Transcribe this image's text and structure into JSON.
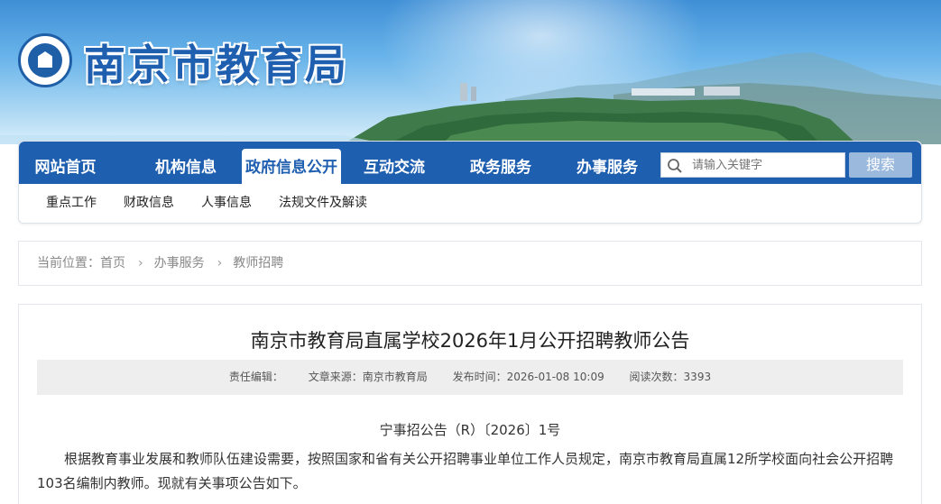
{
  "header": {
    "site_title": "南京市教育局",
    "logo_icon": "nanjing-education-emblem"
  },
  "nav": {
    "items": [
      {
        "label": "网站首页",
        "active": false
      },
      {
        "label": "机构信息",
        "active": false
      },
      {
        "label": "政府信息公开",
        "active": true
      },
      {
        "label": "互动交流",
        "active": false
      },
      {
        "label": "政务服务",
        "active": false
      },
      {
        "label": "办事服务",
        "active": false
      }
    ],
    "search_placeholder": "请输入关键字",
    "search_button": "搜索",
    "search_icon": "search-icon"
  },
  "subnav": {
    "items": [
      "重点工作",
      "财政信息",
      "人事信息",
      "法规文件及解读"
    ]
  },
  "breadcrumb": {
    "prefix": "当前位置：",
    "items": [
      "首页",
      "办事服务",
      "教师招聘"
    ]
  },
  "article": {
    "title": "南京市教育局直属学校2026年1月公开招聘教师公告",
    "meta": {
      "editor": "责任编辑：",
      "source": "文章来源：南京市教育局",
      "publish_time": "发布时间：2026-01-08 10:09",
      "views": "阅读次数：3393"
    },
    "doc_number": "宁事招公告（R）〔2026〕1号",
    "body": "根据教育事业发展和教师队伍建设需要，按照国家和省有关公开招聘事业单位工作人员规定，南京市教育局直属12所学校面向社会公开招聘103名编制内教师。现就有关事项公告如下。"
  },
  "colors": {
    "primary": "#1f5fb0",
    "search_button": "#9bb9dd",
    "meta_bg": "#eeeeee"
  }
}
